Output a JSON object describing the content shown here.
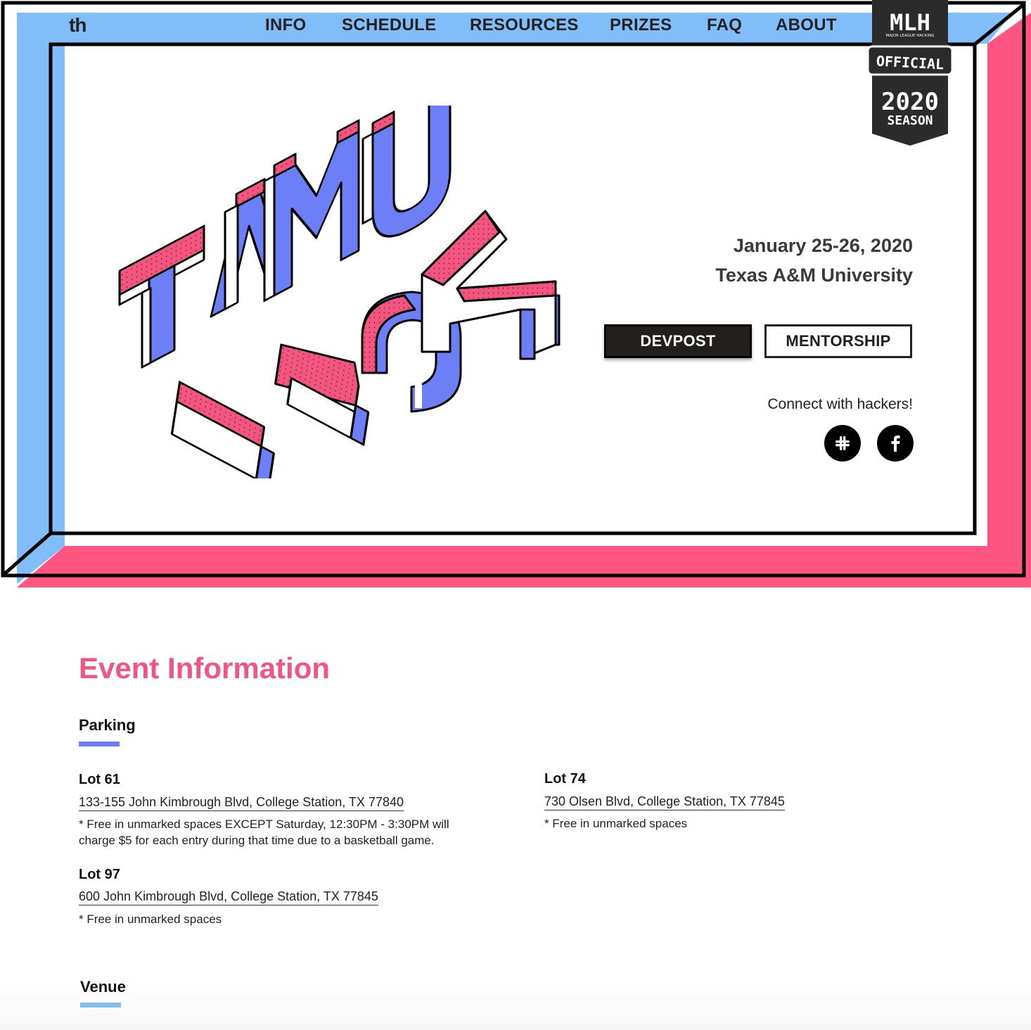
{
  "brand": "th",
  "nav": [
    "INFO",
    "SCHEDULE",
    "RESOURCES",
    "PRIZES",
    "FAQ",
    "ABOUT"
  ],
  "mlh_badge": {
    "top": "MLH",
    "small": "MAJOR LEAGUE HACKING",
    "official": "OFFICIAL",
    "year": "2020",
    "season": "SEASON"
  },
  "logo": {
    "line1": "TAMU",
    "line2": "HACK"
  },
  "hero": {
    "date": "January 25-26, 2020",
    "location": "Texas A&M University",
    "devpost": "DEVPOST",
    "mentorship": "MENTORSHIP",
    "connect": "Connect with hackers!"
  },
  "social": [
    "slack-icon",
    "facebook-icon"
  ],
  "colors": {
    "blue": "#80bdf9",
    "pink": "#ff5582",
    "accent_pink": "#f2557f",
    "indigo": "#6d7ff7",
    "dark": "#231f1c"
  },
  "event": {
    "title": "Event Information",
    "parking_label": "Parking",
    "lots": [
      {
        "name": "Lot 61",
        "address": "133-155 John Kimbrough Blvd, College Station, TX 77840",
        "note": "* Free in unmarked spaces EXCEPT Saturday, 12:30PM - 3:30PM will charge $5 for each entry during that time due to a basketball game."
      },
      {
        "name": "Lot 74",
        "address": "730 Olsen Blvd, College Station, TX 77845",
        "note": "* Free in unmarked spaces"
      },
      {
        "name": "Lot 97",
        "address": "600 John Kimbrough Blvd, College Station, TX 77845",
        "note": "* Free in unmarked spaces"
      }
    ],
    "venue_label": "Venue"
  }
}
